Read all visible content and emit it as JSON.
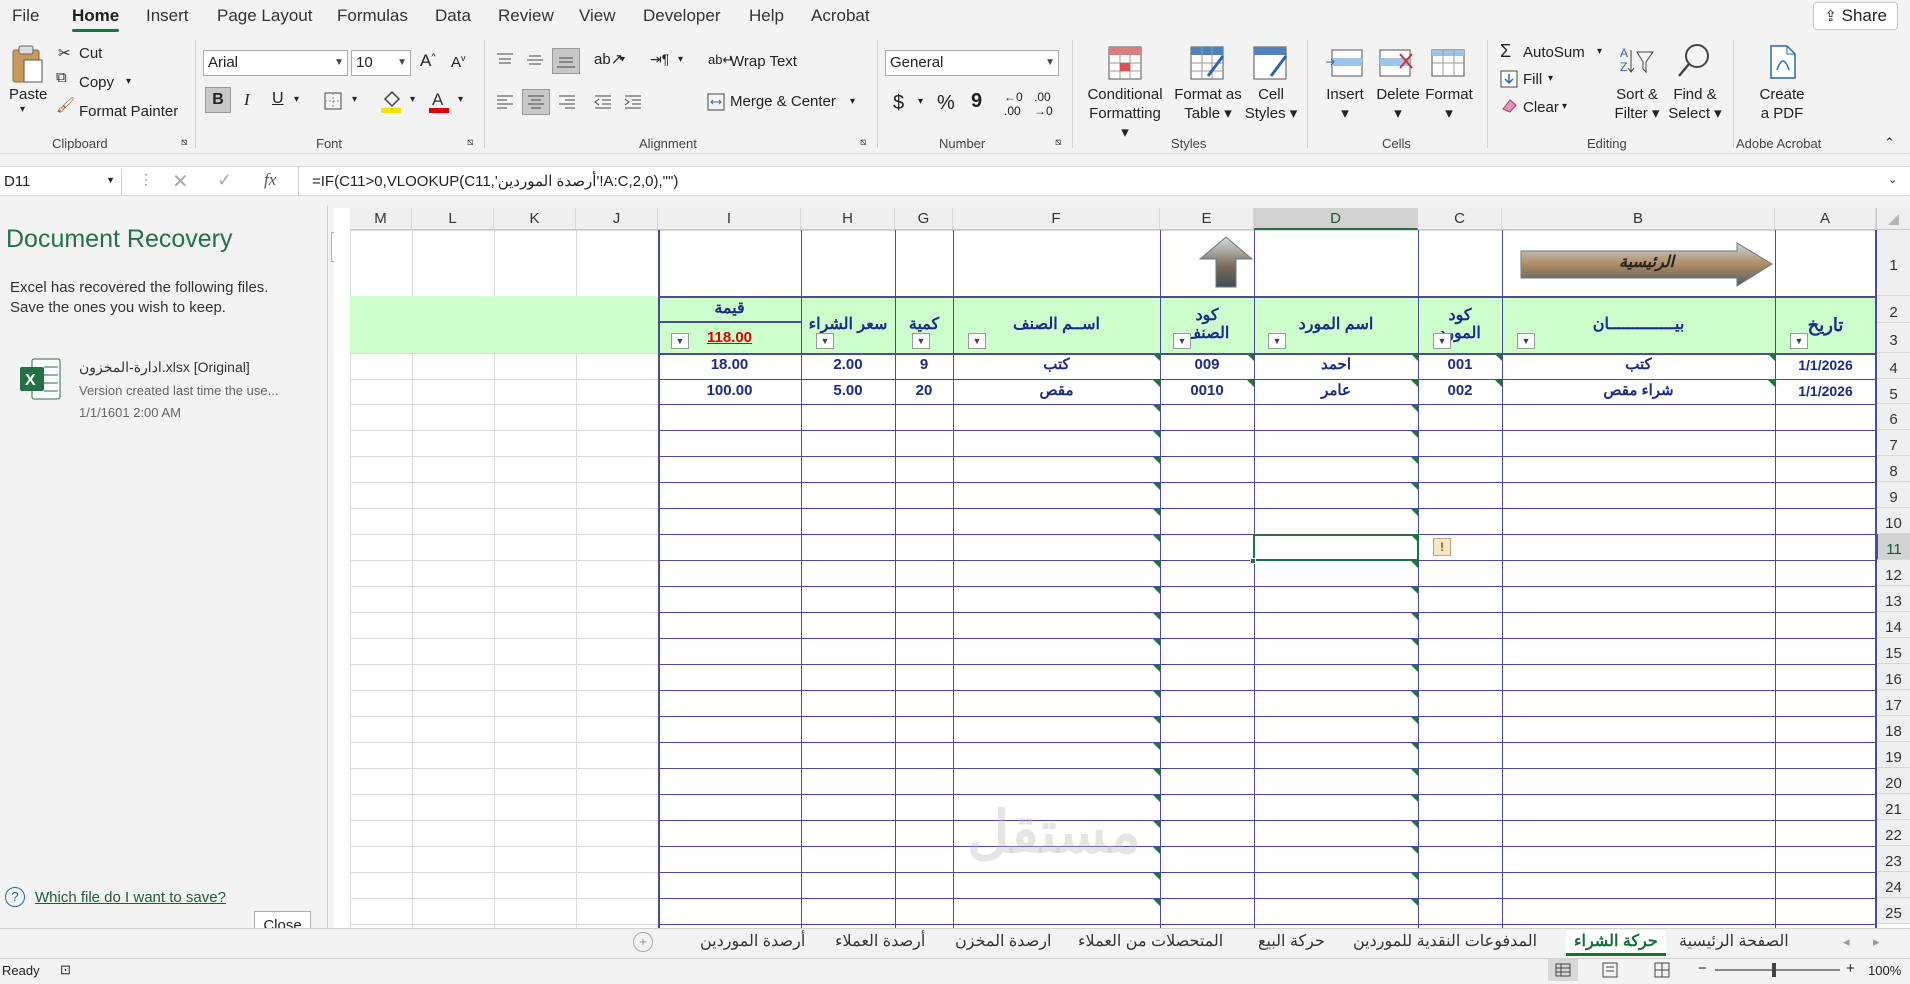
{
  "menu": {
    "items": [
      "File",
      "Home",
      "Insert",
      "Page Layout",
      "Formulas",
      "Data",
      "Review",
      "View",
      "Developer",
      "Help",
      "Acrobat"
    ],
    "active": "Home",
    "share_label": "Share"
  },
  "ribbon": {
    "clipboard": {
      "paste": "Paste",
      "cut": "Cut",
      "copy": "Copy",
      "format_painter": "Format Painter",
      "label": "Clipboard"
    },
    "font": {
      "family": "Arial",
      "size": "10",
      "bold": "B",
      "italic": "I",
      "underline": "U",
      "label": "Font"
    },
    "alignment": {
      "wrap_text": "Wrap Text",
      "merge_center": "Merge & Center",
      "label": "Alignment"
    },
    "number": {
      "format": "General",
      "currency": "$",
      "percent": "%",
      "comma": "9",
      "label": "Number"
    },
    "styles": {
      "conditional_1": "Conditional",
      "conditional_2": "Formatting",
      "format_table_1": "Format as",
      "format_table_2": "Table",
      "cell_styles_1": "Cell",
      "cell_styles_2": "Styles",
      "label": "Styles"
    },
    "cells": {
      "insert": "Insert",
      "delete": "Delete",
      "format": "Format",
      "label": "Cells"
    },
    "editing": {
      "autosum": "AutoSum",
      "fill": "Fill",
      "clear": "Clear",
      "sort_1": "Sort &",
      "sort_2": "Filter",
      "find_1": "Find &",
      "find_2": "Select",
      "label": "Editing"
    },
    "acrobat": {
      "create_1": "Create",
      "create_2": "a PDF",
      "label": "Adobe Acrobat"
    }
  },
  "formula_bar": {
    "name_box": "D11",
    "fx": "fx",
    "formula": "=IF(C11>0,VLOOKUP(C11,'أرصدة الموردين'!A:C,2,0),\"\")"
  },
  "recovery": {
    "title": "Document Recovery",
    "desc_1": "Excel has recovered the following files.",
    "desc_2": "Save the ones you wish to keep.",
    "file_name": "ادارة-المخزون.xlsx  [Original]",
    "file_desc": "Version created last time the use...",
    "file_date": "1/1/1601 2:00 AM",
    "help_link": "Which file do I want to save?",
    "close_label": "Close"
  },
  "sheet": {
    "columns": [
      "M",
      "L",
      "K",
      "J",
      "I",
      "H",
      "G",
      "F",
      "E",
      "D",
      "C",
      "B",
      "A"
    ],
    "rows": [
      "1",
      "2",
      "3",
      "4",
      "5",
      "6",
      "7",
      "8",
      "9",
      "10",
      "11",
      "12",
      "13",
      "14",
      "15",
      "16",
      "17",
      "18",
      "19",
      "20",
      "21",
      "22",
      "23",
      "24",
      "25"
    ],
    "home_button_text": "الرئيسية",
    "headers": {
      "value": "قيمة",
      "total": "118.00",
      "buy_price": "سعر الشراء",
      "qty": "كمية",
      "item_name": "اســم الصنف",
      "item_code_1": "كود",
      "item_code_2": "الصنف",
      "supplier_name": "اسم المورد",
      "supplier_code_1": "كود",
      "supplier_code_2": "المورد",
      "statement": "بيــــــــــــــان",
      "date": "تاريخ"
    },
    "data_rows": [
      {
        "value": "18.00",
        "price": "2.00",
        "qty": "9",
        "item": "كتب",
        "item_code": "009",
        "supplier": "احمد",
        "supplier_code": "001",
        "statement": "كتب",
        "date": "1/1/2026"
      },
      {
        "value": "100.00",
        "price": "5.00",
        "qty": "20",
        "item": "مقص",
        "item_code": "0010",
        "supplier": "عامر",
        "supplier_code": "002",
        "statement": "شراء مقص",
        "date": "1/1/2026"
      }
    ]
  },
  "tabs": {
    "items": [
      "الصفحة الرئيسية",
      "حركة الشراء",
      "المدفوعات النقدية للموردين",
      "حركة البيع",
      "المتحصلات من العملاء",
      "ارصدة المخزن",
      "أرصدة العملاء",
      "أرصدة الموردين"
    ],
    "active": "حركة الشراء"
  },
  "status": {
    "ready": "Ready",
    "zoom": "100%"
  },
  "watermark": "مستقل",
  "colors": {
    "accent": "#217346",
    "header_fill": "#ccffcc",
    "data_text": "#1c2b8a",
    "total_text": "#e00000"
  }
}
